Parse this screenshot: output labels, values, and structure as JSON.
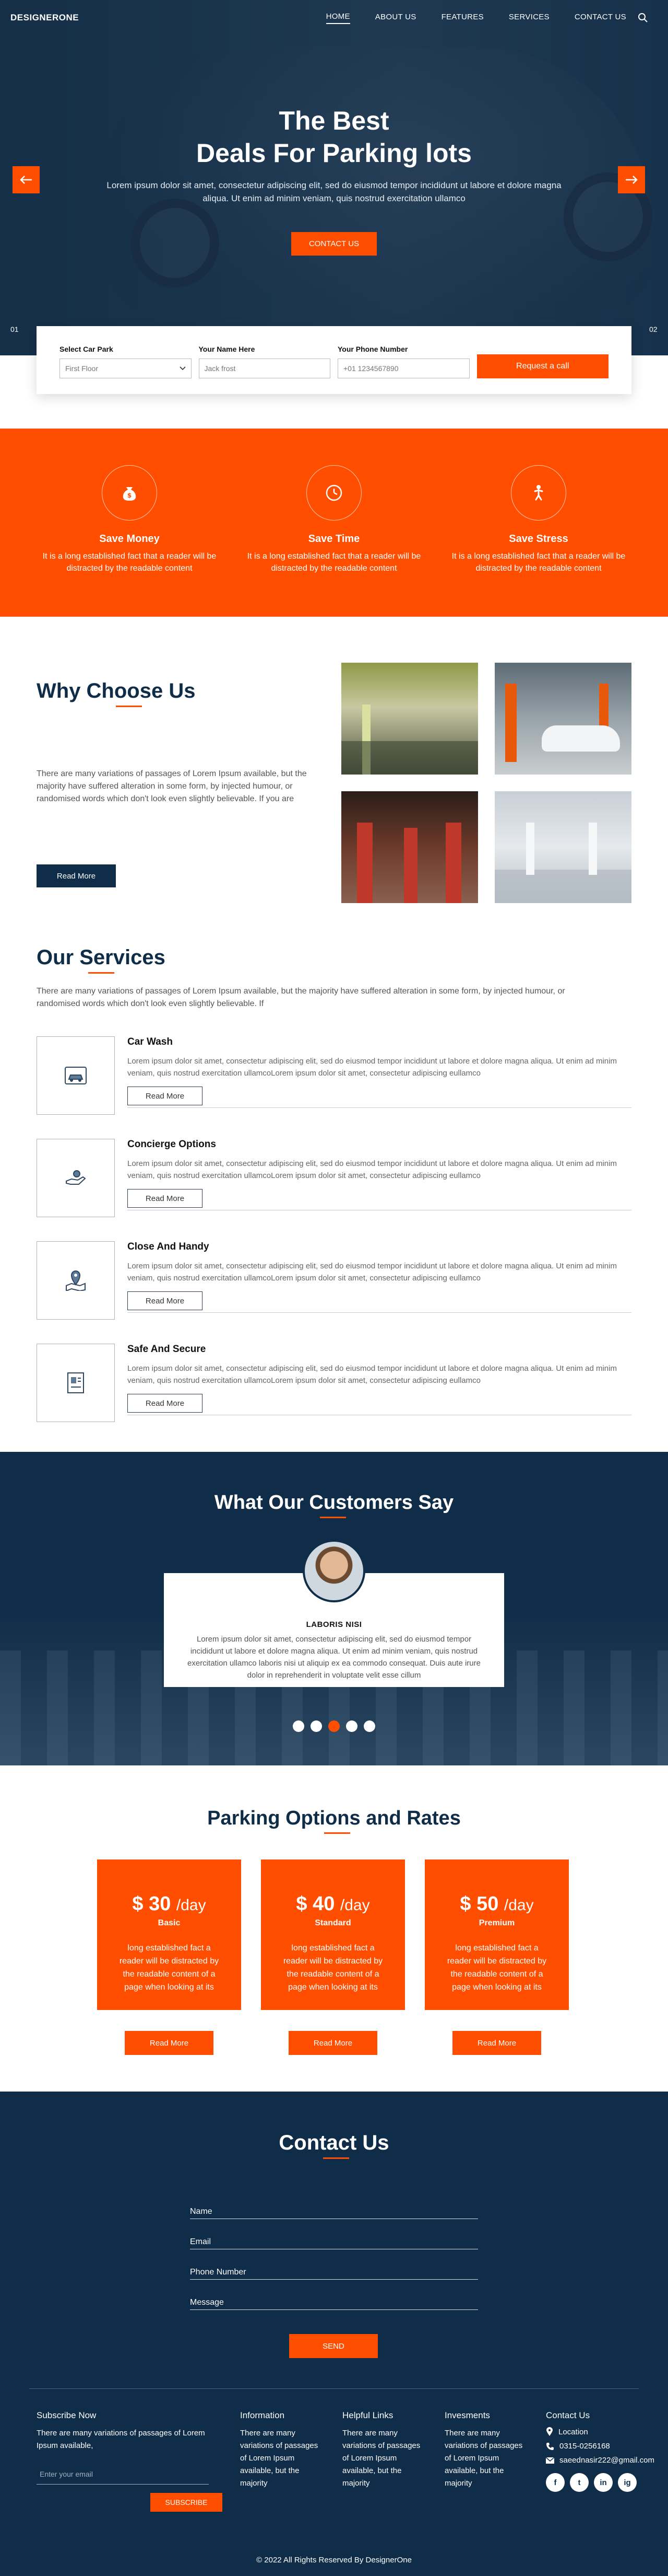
{
  "nav": {
    "brand": "DESIGNERONE",
    "items": [
      {
        "label": "HOME",
        "active": true
      },
      {
        "label": "ABOUT US",
        "active": false
      },
      {
        "label": "FEATURES",
        "active": false
      },
      {
        "label": "SERVICES",
        "active": false
      },
      {
        "label": "CONTACT US",
        "active": false
      }
    ],
    "search_icon": "search-icon"
  },
  "hero": {
    "title_line1": "The Best",
    "title_line2": "Deals For Parking lots",
    "text": "Lorem ipsum dolor sit amet, consectetur adipiscing elit, sed do eiusmod tempor incididunt ut labore et dolore magna aliqua. Ut enim ad minim veniam, quis nostrud exercitation ullamco",
    "button": "CONTACT US",
    "slide_left": "01",
    "slide_right": "02",
    "prev_icon": "arrow-left-icon",
    "next_icon": "arrow-right-icon"
  },
  "booking": {
    "park_label": "Select Car Park",
    "park_value": "First Floor",
    "name_label": "Your Name Here",
    "name_placeholder": "Jack frost",
    "phone_label": "Your Phone Number",
    "phone_placeholder": "+01 1234567890",
    "button": "Request a call"
  },
  "features": [
    {
      "title": "Save Money",
      "text": "It is a long established fact that a reader will be distracted by the readable content",
      "icon": "money-bag-icon"
    },
    {
      "title": "Save Time",
      "text": "It is a long established fact that a reader will be distracted by the readable content",
      "icon": "clock-icon"
    },
    {
      "title": "Save Stress",
      "text": "It is a long established fact that a reader will be distracted by the readable content",
      "icon": "relax-person-icon"
    }
  ],
  "why": {
    "title": "Why Choose Us",
    "text": "There are many variations of passages of Lorem Ipsum available, but the majority have suffered alteration in some form, by injected humour, or randomised words which don't look even slightly believable. If you are",
    "button": "Read More"
  },
  "services": {
    "title": "Our Services",
    "intro": "There are many variations of passages of Lorem Ipsum available, but the majority have suffered alteration in some form, by injected humour, or randomised words which don't look even slightly believable. If",
    "items": [
      {
        "title": "Car Wash",
        "text": "Lorem ipsum dolor sit amet, consectetur adipiscing elit, sed do eiusmod tempor incididunt ut labore et dolore magna aliqua. Ut enim ad minim veniam, quis nostrud exercitation ullamcoLorem ipsum dolor sit amet, consectetur adipiscing eullamco",
        "button": "Read More",
        "icon": "car-wash-icon"
      },
      {
        "title": "Concierge Options",
        "text": "Lorem ipsum dolor sit amet, consectetur adipiscing elit, sed do eiusmod tempor incididunt ut labore et dolore magna aliqua. Ut enim ad minim veniam, quis nostrud exercitation ullamcoLorem ipsum dolor sit amet, consectetur adipiscing eullamco",
        "button": "Read More",
        "icon": "concierge-hand-icon"
      },
      {
        "title": "Close And Handy",
        "text": "Lorem ipsum dolor sit amet, consectetur adipiscing elit, sed do eiusmod tempor incididunt ut labore et dolore magna aliqua. Ut enim ad minim veniam, quis nostrud exercitation ullamcoLorem ipsum dolor sit amet, consectetur adipiscing eullamco",
        "button": "Read More",
        "icon": "map-pin-icon"
      },
      {
        "title": "Safe And Secure",
        "text": "Lorem ipsum dolor sit amet, consectetur adipiscing elit, sed do eiusmod tempor incididunt ut labore et dolore magna aliqua. Ut enim ad minim veniam, quis nostrud exercitation ullamcoLorem ipsum dolor sit amet, consectetur adipiscing eullamco",
        "button": "Read More",
        "icon": "secure-document-icon"
      }
    ]
  },
  "testimonial": {
    "title": "What Our Customers Say",
    "name": "LABORIS NISI",
    "text": "Lorem ipsum dolor sit amet, consectetur adipiscing elit, sed do eiusmod tempor incididunt ut labore et dolore magna aliqua. Ut enim ad minim veniam, quis nostrud exercitation ullamco laboris nisi ut aliquip ex ea commodo consequat. Duis aute irure dolor in reprehenderit in voluptate velit esse cillum",
    "active_dot": 3
  },
  "pricing": {
    "title": "Parking Options and Rates",
    "plans": [
      {
        "price": "$ 30",
        "unit": "/day",
        "tier": "Basic",
        "desc": "long established fact a reader will be distracted by the readable content of a page when looking at its",
        "button": "Read More"
      },
      {
        "price": "$ 40",
        "unit": "/day",
        "tier": "Standard",
        "desc": "long established fact a reader will be distracted by the readable content of a page when looking at its",
        "button": "Read More"
      },
      {
        "price": "$ 50",
        "unit": "/day",
        "tier": "Premium",
        "desc": "long established fact a reader will be distracted by the readable content of a page when looking at its",
        "button": "Read More"
      }
    ]
  },
  "contact": {
    "title": "Contact Us",
    "name_label": "Name",
    "email_label": "Email",
    "phone_label": "Phone Number",
    "message_label": "Message",
    "send": "SEND"
  },
  "footer": {
    "subscribe_title": "Subscribe Now",
    "subscribe_text": "There are many variations of passages of Lorem Ipsum available,",
    "email_placeholder": "Enter your email",
    "subscribe_button": "SUBSCRIBE",
    "info_title": "Information",
    "info_text": "There are many variations of passages of Lorem Ipsum available, but the majority",
    "links_title": "Helpful Links",
    "links_text": "There are many variations of passages of Lorem Ipsum available, but the majority",
    "invest_title": "Invesments",
    "invest_text": "There are many variations of passages of Lorem Ipsum available, but the majority",
    "contact_title": "Contact Us",
    "location": "Location",
    "phone": "0315-0256168",
    "email": "saeednasir222@gmail.com",
    "social": [
      "f",
      "t",
      "in",
      "ig"
    ],
    "copyright": "© 2022 All Rights Reserved By DesignerOne"
  },
  "colors": {
    "accent": "#ff4e00",
    "navy": "#0f2d48"
  }
}
